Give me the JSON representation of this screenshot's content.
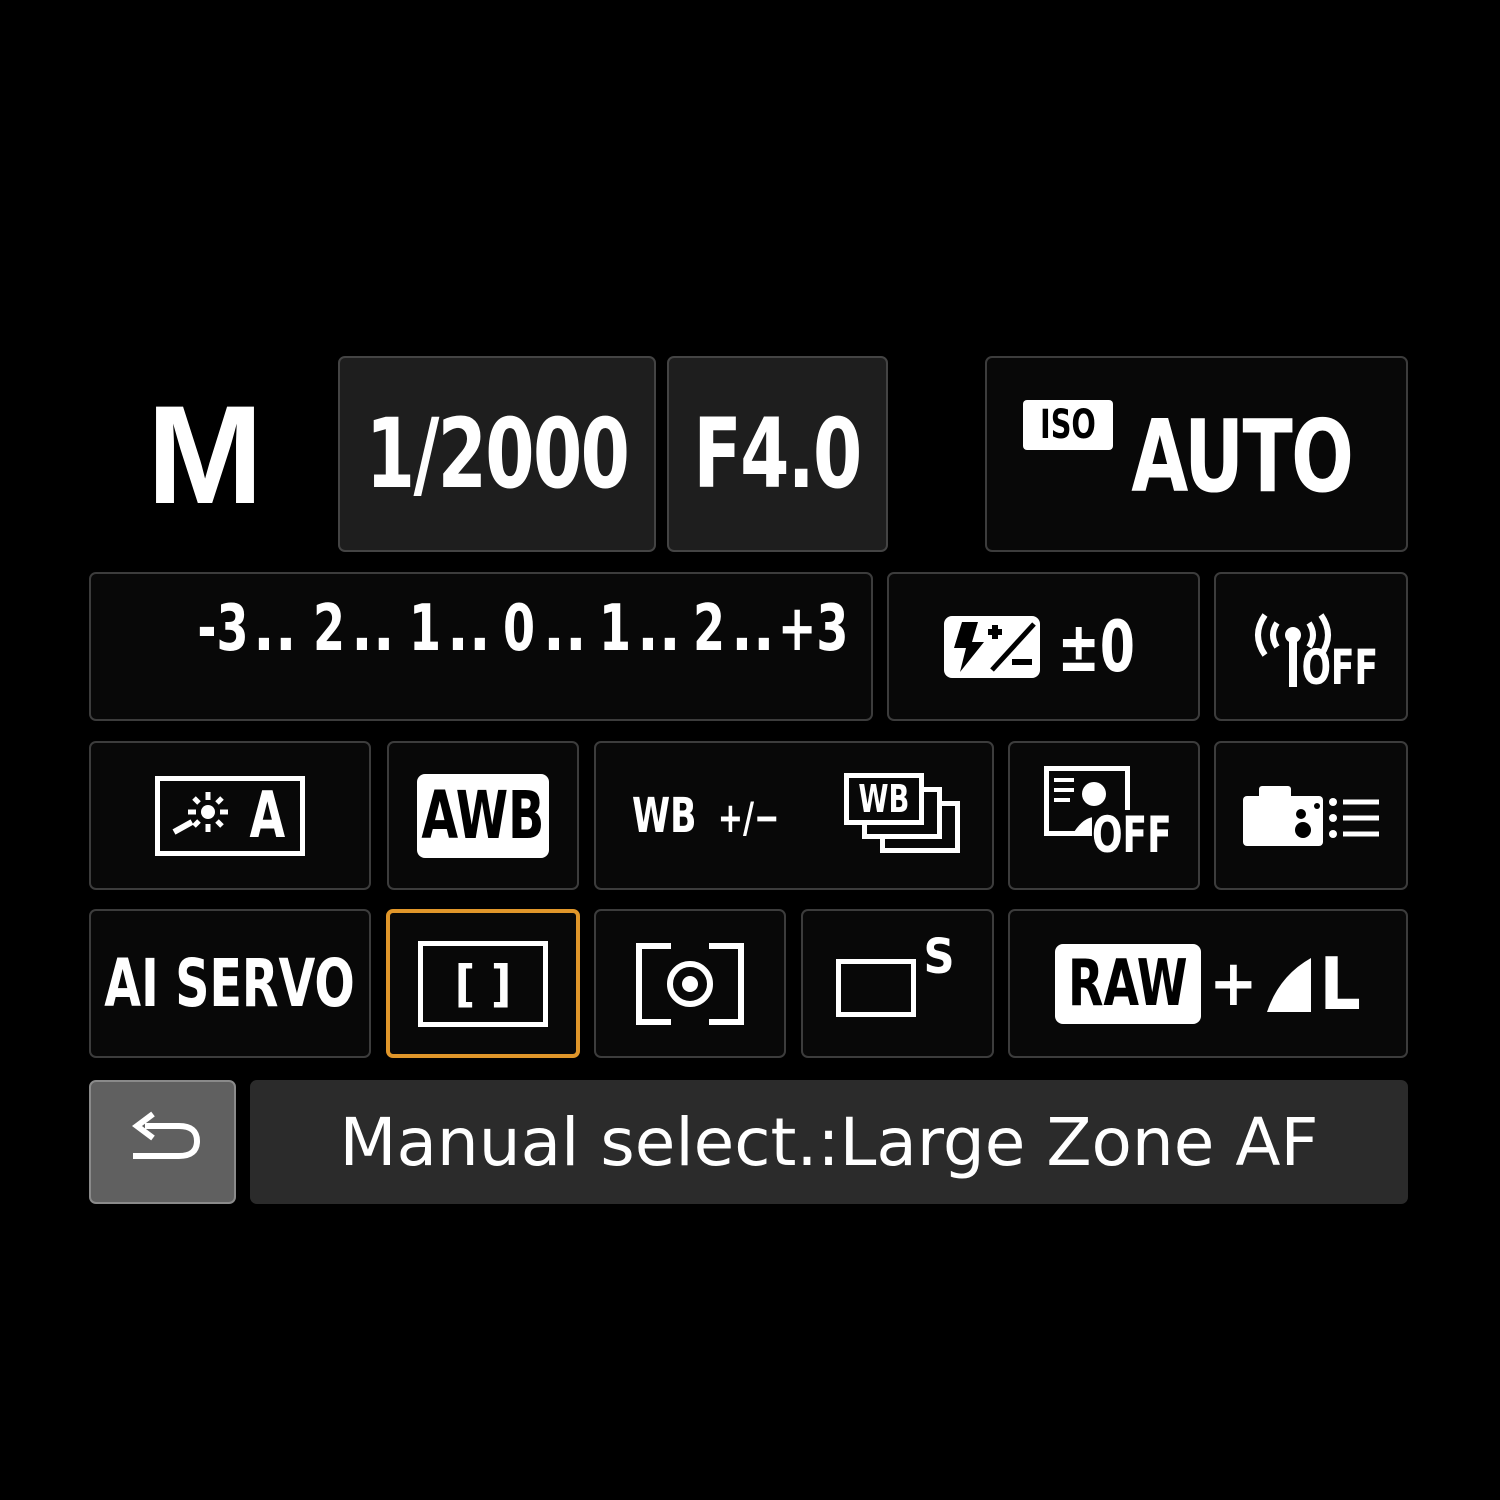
{
  "mode": "M",
  "shutter": "1/2000",
  "aperture": "F4.0",
  "iso": {
    "badge": "ISO",
    "value": "AUTO"
  },
  "exposure_scale": {
    "labels": [
      "-3",
      "2",
      "1",
      "0",
      "1",
      "2",
      "+3"
    ],
    "value": 0
  },
  "flash_comp": {
    "icon": "flash-exposure-compensation-icon",
    "value": "±0"
  },
  "wireless": {
    "icon": "wireless-icon",
    "state": "OFF"
  },
  "picture_style": {
    "icon": "picture-style-icon",
    "value": "A"
  },
  "white_balance": {
    "badge": "AWB"
  },
  "wb_shift": {
    "line1": "WB",
    "line2": "+/−",
    "bracket_icon": "wb-bracketing-icon",
    "bracket_label": "WB"
  },
  "alo": {
    "icon": "auto-lighting-optimizer-icon",
    "state": "OFF"
  },
  "custom_controls": {
    "icon": "camera-custom-controls-icon"
  },
  "af_operation": "AI SERVO",
  "af_area": {
    "icon": "large-zone-af-icon",
    "glyph": "[ ]"
  },
  "metering": {
    "icon": "evaluative-metering-icon"
  },
  "drive": {
    "icon": "single-shot-drive-icon",
    "suffix": "S"
  },
  "image_quality": {
    "raw": "RAW",
    "plus": "+",
    "size": "L"
  },
  "footer": {
    "back_icon": "return-icon",
    "status": "Manual select.:Large Zone AF"
  },
  "colors": {
    "background": "#000000",
    "cell_border": "#3c3c3c",
    "selected_border": "#e0962a",
    "text": "#ffffff"
  }
}
